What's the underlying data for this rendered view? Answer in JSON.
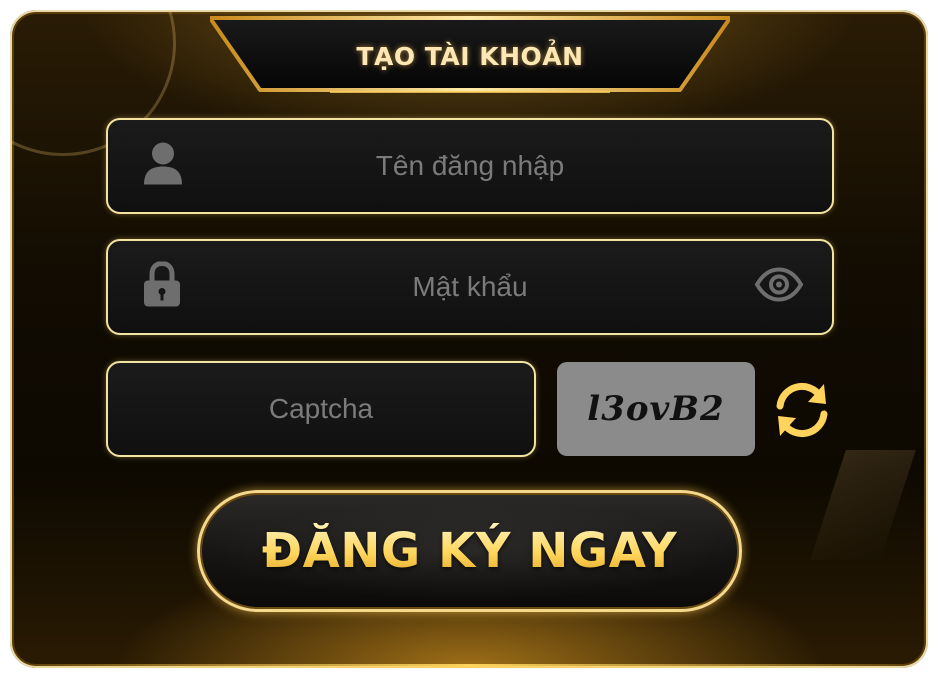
{
  "header": {
    "title": "TẠO TÀI KHOẢN"
  },
  "form": {
    "username": {
      "placeholder": "Tên đăng nhập",
      "value": "",
      "icon": "user-icon"
    },
    "password": {
      "placeholder": "Mật khẩu",
      "value": "",
      "icon": "lock-icon",
      "toggle_icon": "eye-icon"
    },
    "captcha": {
      "placeholder": "Captcha",
      "value": "",
      "image_text": "l3ovB2",
      "refresh_icon": "refresh-icon"
    }
  },
  "submit": {
    "label": "ĐĂNG KÝ NGAY"
  },
  "colors": {
    "accent_gold": "#ffd55a",
    "border_gold": "#f3e3a0",
    "field_bg": "#151515",
    "captcha_bg": "#8b8b8b",
    "icon_gray": "#6e6e6e"
  }
}
